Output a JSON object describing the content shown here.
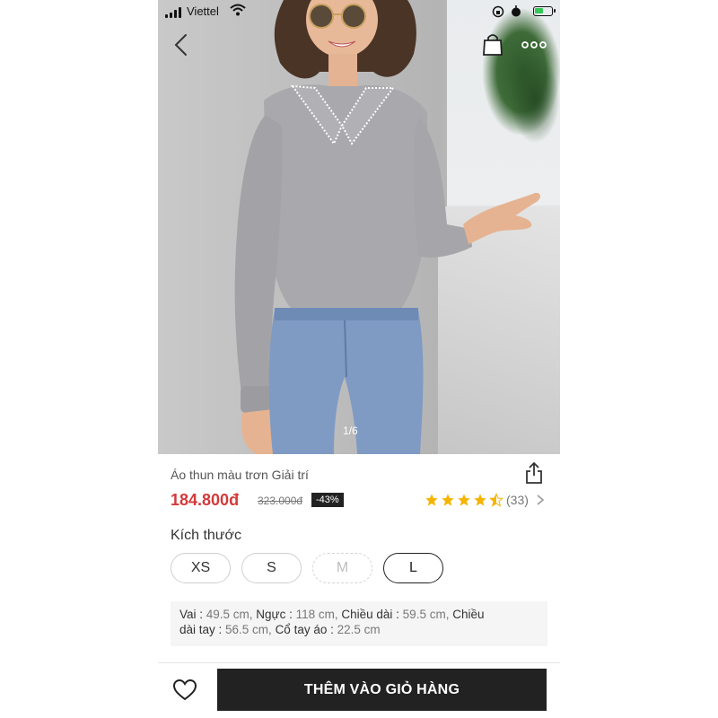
{
  "status_bar": {
    "carrier": "Viettel",
    "icons": [
      "signal-icon",
      "wifi-icon",
      "orientation-lock-icon",
      "alarm-icon",
      "battery-icon"
    ]
  },
  "nav": {
    "icons": [
      "back-chevron-icon",
      "shopping-bag-icon",
      "more-dots-icon"
    ]
  },
  "gallery": {
    "counter": "1/6"
  },
  "product": {
    "title": "Áo thun màu trơn Giải trí",
    "price": "184.800đ",
    "old_price": "323.000đ",
    "discount": "-43%",
    "rating": {
      "stars": 4.5,
      "count_text": "(33)"
    }
  },
  "size": {
    "label": "Kích thước",
    "options": [
      {
        "label": "XS",
        "state": "available"
      },
      {
        "label": "S",
        "state": "available"
      },
      {
        "label": "M",
        "state": "disabled"
      },
      {
        "label": "L",
        "state": "selected"
      }
    ]
  },
  "measurements": {
    "line1": [
      {
        "key": "Vai : ",
        "value": "49.5 cm, "
      },
      {
        "key": " Ngực : ",
        "value": "118 cm, "
      },
      {
        "key": " Chiều dài : ",
        "value": "59.5 cm, "
      },
      {
        "key": " Chiều",
        "value": ""
      }
    ],
    "line2": [
      {
        "key": "dài tay : ",
        "value": "56.5 cm, "
      },
      {
        "key": " Cổ tay áo : ",
        "value": "22.5 cm"
      }
    ]
  },
  "footer": {
    "add_to_cart": "THÊM VÀO GIỎ HÀNG"
  },
  "colors": {
    "price": "#d33a3a",
    "star": "#f5b400",
    "button_bg": "#222222",
    "battery": "#34c759"
  }
}
